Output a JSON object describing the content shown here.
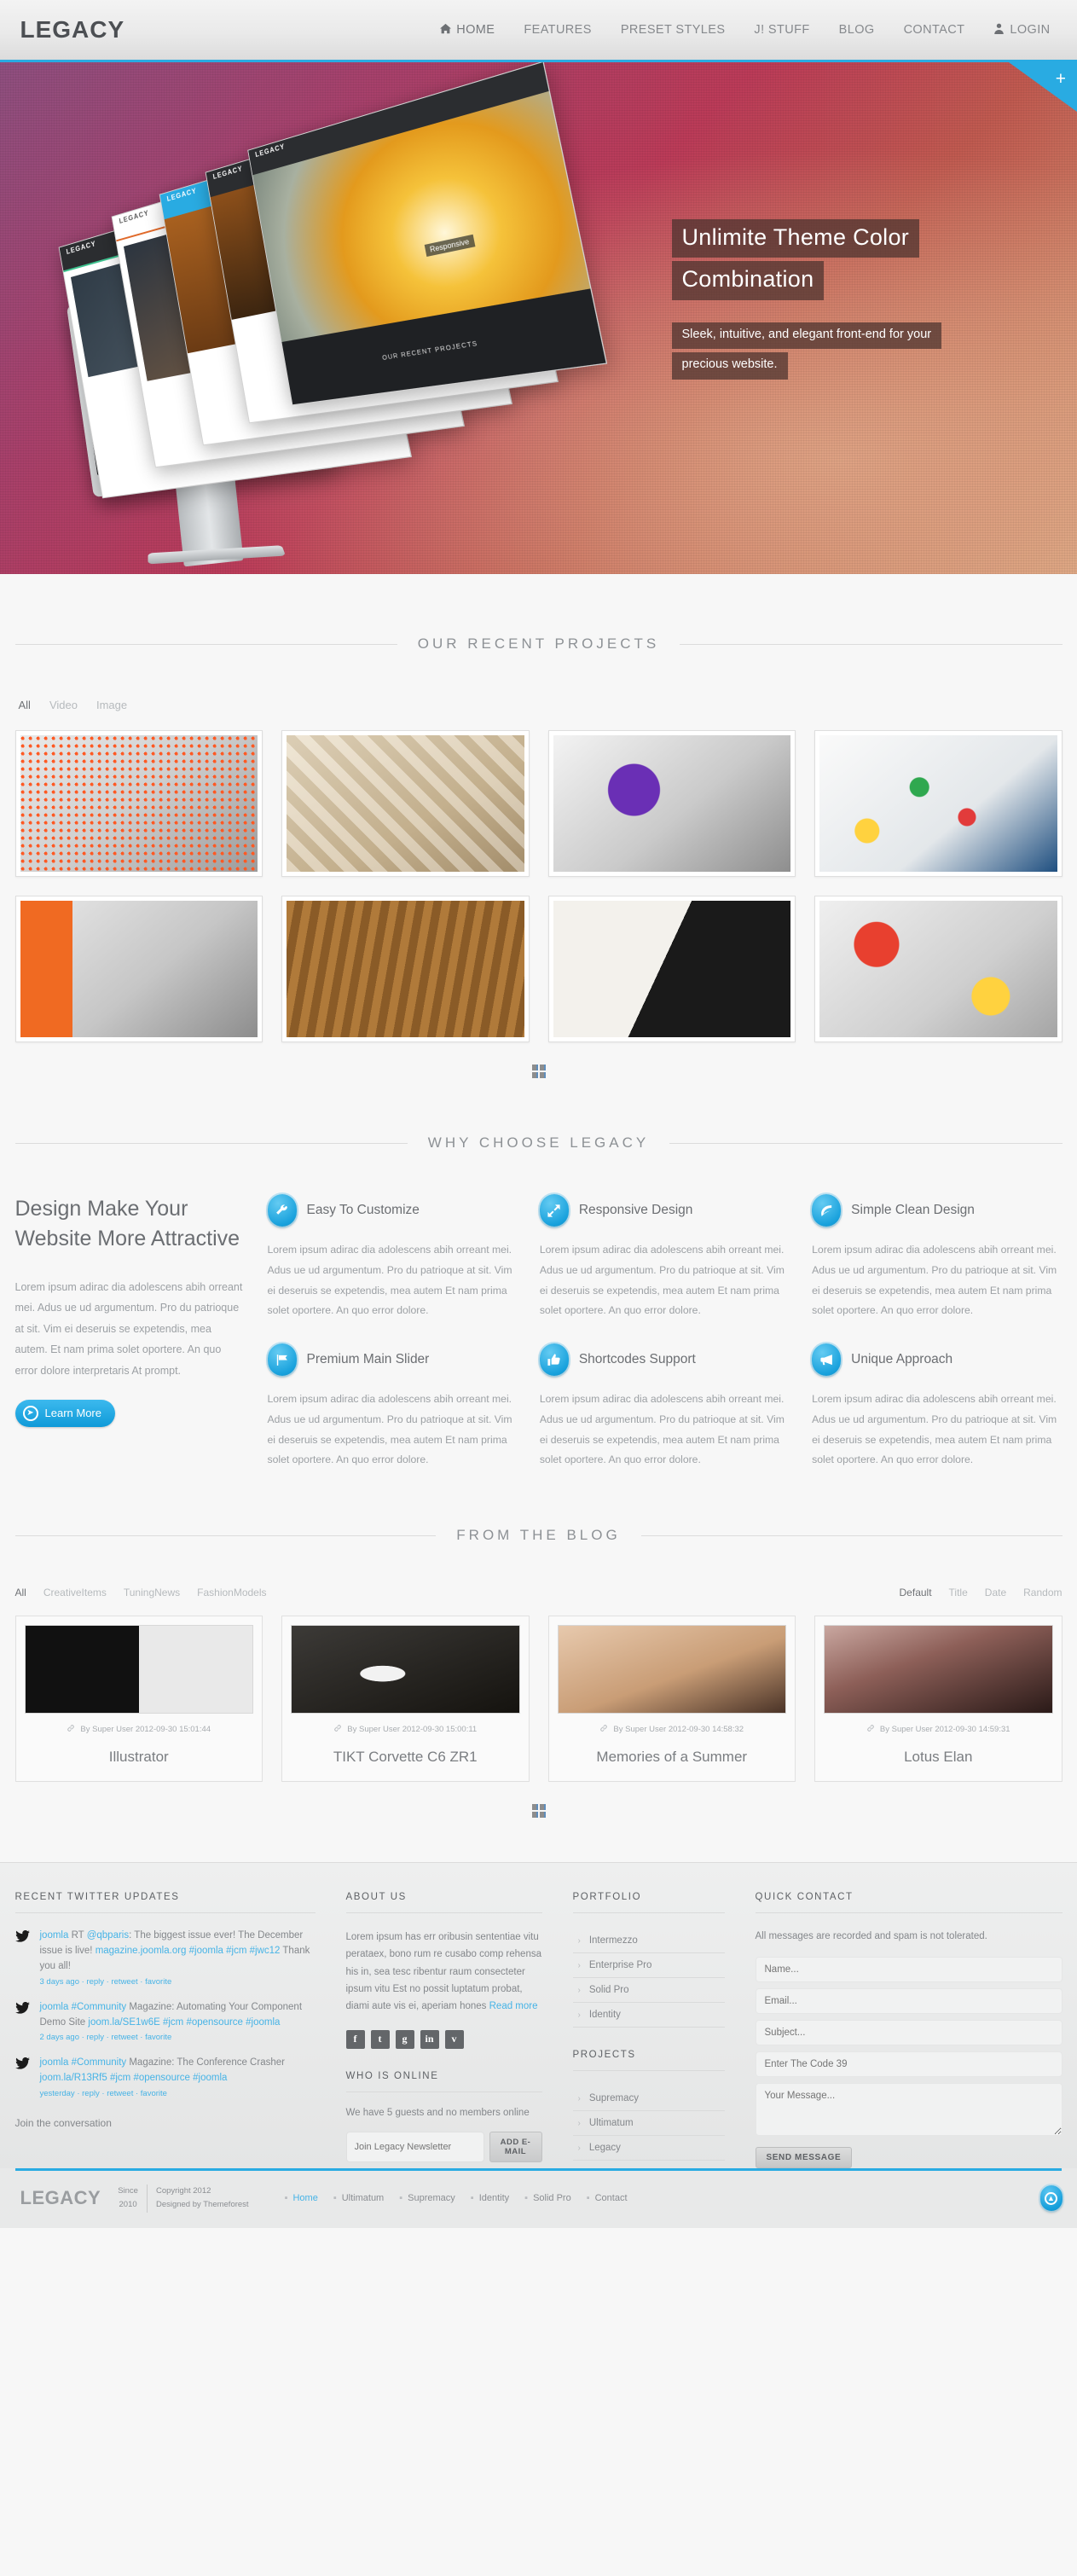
{
  "header": {
    "logo": "LEGACY",
    "nav": [
      {
        "label": "HOME",
        "icon": "home-icon",
        "active": true
      },
      {
        "label": "FEATURES",
        "active": false
      },
      {
        "label": "PRESET STYLES",
        "active": false
      },
      {
        "label": "J! STUFF",
        "active": false
      },
      {
        "label": "BLOG",
        "active": false
      },
      {
        "label": "CONTACT",
        "active": false
      },
      {
        "label": "LOGIN",
        "icon": "user-icon",
        "active": false
      }
    ]
  },
  "hero": {
    "corner_badge": "+",
    "title_line1": "Unlimite Theme Color",
    "title_line2": "Combination",
    "sub_line1": "Sleek, intuitive, and elegant front-end for your",
    "sub_line2": "precious website.",
    "mockup_logo": "LEGACY",
    "mockup_tag": "Responsive",
    "mockup_section": "OUR RECENT PROJECTS"
  },
  "projects": {
    "title": "OUR RECENT PROJECTS",
    "filters": [
      {
        "label": "All",
        "active": true
      },
      {
        "label": "Video",
        "active": false
      },
      {
        "label": "Image",
        "active": false
      }
    ],
    "items": [
      {
        "name": "project-orange-poster"
      },
      {
        "name": "project-wood-blocks"
      },
      {
        "name": "project-shirt-purple"
      },
      {
        "name": "project-identity-system"
      },
      {
        "name": "project-brochure-set"
      },
      {
        "name": "project-wood-engraved"
      },
      {
        "name": "project-black-stationery"
      },
      {
        "name": "project-colorful-cards"
      }
    ],
    "pager_icon": "grid-icon"
  },
  "why": {
    "title": "WHY CHOOSE LEGACY",
    "heading": "Design Make Your Website More Attractive",
    "paragraph": "Lorem ipsum adirac dia adolescens abih orreant mei. Adus ue ud argumentum. Pro du patrioque at sit. Vim ei deseruis se expetendis, mea autem. Et nam prima solet oportere. An quo error dolore interpretaris At prompt.",
    "button": "Learn More",
    "features": [
      {
        "icon": "wrench-icon",
        "title": "Easy To Customize",
        "text": "Lorem ipsum adirac dia adolescens abih orreant mei. Adus ue ud argumentum. Pro du patrioque at sit. Vim ei deseruis se expetendis, mea autem Et nam prima solet oportere. An quo error dolore."
      },
      {
        "icon": "expand-icon",
        "title": "Responsive Design",
        "text": "Lorem ipsum adirac dia adolescens abih orreant mei. Adus ue ud argumentum. Pro du patrioque at sit. Vim ei deseruis se expetendis, mea autem Et nam prima solet oportere. An quo error dolore."
      },
      {
        "icon": "leaf-icon",
        "title": "Simple Clean Design",
        "text": "Lorem ipsum adirac dia adolescens abih orreant mei. Adus ue ud argumentum. Pro du patrioque at sit. Vim ei deseruis se expetendis, mea autem Et nam prima solet oportere. An quo error dolore."
      },
      {
        "icon": "flag-icon",
        "title": "Premium Main Slider",
        "text": "Lorem ipsum adirac dia adolescens abih orreant mei. Adus ue ud argumentum. Pro du patrioque at sit. Vim ei deseruis se expetendis, mea autem Et nam prima solet oportere. An quo error dolore."
      },
      {
        "icon": "thumbs-up-icon",
        "title": "Shortcodes Support",
        "text": "Lorem ipsum adirac dia adolescens abih orreant mei. Adus ue ud argumentum. Pro du patrioque at sit. Vim ei deseruis se expetendis, mea autem Et nam prima solet oportere. An quo error dolore."
      },
      {
        "icon": "megaphone-icon",
        "title": "Unique Approach",
        "text": "Lorem ipsum adirac dia adolescens abih orreant mei. Adus ue ud argumentum. Pro du patrioque at sit. Vim ei deseruis se expetendis, mea autem Et nam prima solet oportere. An quo error dolore."
      }
    ]
  },
  "blog": {
    "title": "FROM THE BLOG",
    "filters": [
      {
        "label": "All",
        "active": true
      },
      {
        "label": "CreativeItems",
        "active": false
      },
      {
        "label": "TuningNews",
        "active": false
      },
      {
        "label": "FashionModels",
        "active": false
      }
    ],
    "sorts": [
      {
        "label": "Default",
        "active": true
      },
      {
        "label": "Title",
        "active": false
      },
      {
        "label": "Date",
        "active": false
      },
      {
        "label": "Random",
        "active": false
      }
    ],
    "posts": [
      {
        "meta": "By Super User 2012-09-30 15:01:44",
        "title": "Illustrator"
      },
      {
        "meta": "By Super User 2012-09-30 15:00:11",
        "title": "TIKT Corvette C6 ZR1"
      },
      {
        "meta": "By Super User 2012-09-30 14:58:32",
        "title": "Memories of a Summer"
      },
      {
        "meta": "By Super User 2012-09-30 14:59:31",
        "title": "Lotus Elan"
      }
    ],
    "pager_icon": "grid-icon"
  },
  "footer": {
    "twitter": {
      "heading": "RECENT TWITTER UPDATES",
      "tweets": [
        {
          "user": "joomla",
          "parts": [
            {
              "t": " RT ",
              "link": false
            },
            {
              "t": "@qbparis",
              "link": true
            },
            {
              "t": ": The biggest issue ever! The December issue is live! ",
              "link": false
            },
            {
              "t": "magazine.joomla.org",
              "link": true
            },
            {
              "t": " ",
              "link": false
            },
            {
              "t": "#joomla #jcm #jwc12",
              "link": true
            },
            {
              "t": " Thank you all!",
              "link": false
            }
          ],
          "time": "3 days ago",
          "actions": [
            "reply",
            "retweet",
            "favorite"
          ]
        },
        {
          "user": "joomla",
          "parts": [
            {
              "t": " ",
              "link": false
            },
            {
              "t": "#Community",
              "link": true
            },
            {
              "t": " Magazine: Automating Your Component Demo Site ",
              "link": false
            },
            {
              "t": "joom.la/SE1w6E",
              "link": true
            },
            {
              "t": " ",
              "link": false
            },
            {
              "t": "#jcm #opensource #joomla",
              "link": true
            }
          ],
          "time": "2 days ago",
          "actions": [
            "reply",
            "retweet",
            "favorite"
          ]
        },
        {
          "user": "joomla",
          "parts": [
            {
              "t": " ",
              "link": false
            },
            {
              "t": "#Community",
              "link": true
            },
            {
              "t": " Magazine: The Conference Crasher ",
              "link": false
            },
            {
              "t": "joom.la/R13Rf5",
              "link": true
            },
            {
              "t": " ",
              "link": false
            },
            {
              "t": "#jcm #opensource #joomla",
              "link": true
            }
          ],
          "time": "yesterday",
          "actions": [
            "reply",
            "retweet",
            "favorite"
          ]
        }
      ],
      "join": "Join the conversation"
    },
    "about": {
      "heading": "ABOUT US",
      "text": "Lorem ipsum has err oribusin sententiae vitu perataex, bono rum re cusabo comp rehensa his in, sea tesc ribentur raum consecteter ipsum vitu Est no possit luptatum probat, diami aute vis ei, aperiam hones ",
      "read_more": "Read more",
      "socials": [
        {
          "name": "facebook-icon",
          "glyph": "f"
        },
        {
          "name": "twitter-icon",
          "glyph": "t"
        },
        {
          "name": "google-plus-icon",
          "glyph": "g"
        },
        {
          "name": "linkedin-icon",
          "glyph": "in"
        },
        {
          "name": "vimeo-icon",
          "glyph": "v"
        }
      ]
    },
    "online": {
      "heading": "WHO IS ONLINE",
      "text": "We have 5 guests and no members online",
      "newsletter_placeholder": "Join Legacy Newsletter",
      "newsletter_button": "ADD E-MAIL"
    },
    "portfolio": {
      "heading": "PORTFOLIO",
      "items": [
        "Intermezzo",
        "Enterprise Pro",
        "Solid Pro",
        "Identity"
      ]
    },
    "projects": {
      "heading": "PROJECTS",
      "items": [
        "Supremacy",
        "Ultimatum",
        "Legacy"
      ]
    },
    "contact": {
      "heading": "QUICK CONTACT",
      "note": "All messages are recorded and spam is not tolerated.",
      "name_placeholder": "Name...",
      "email_placeholder": "Email...",
      "subject_placeholder": "Subject...",
      "code_placeholder": "Enter The Code 39",
      "message_placeholder": "Your Message...",
      "submit": "SEND MESSAGE"
    }
  },
  "bottom": {
    "logo": "LEGACY",
    "since_l1": "Since",
    "since_l2": "2010",
    "copy_l1": "Copyright 2012",
    "copy_l2": "Designed by Themeforest",
    "nav": [
      {
        "label": "Home",
        "active": true
      },
      {
        "label": "Ultimatum",
        "active": false
      },
      {
        "label": "Supremacy",
        "active": false
      },
      {
        "label": "Identity",
        "active": false
      },
      {
        "label": "Solid Pro",
        "active": false
      },
      {
        "label": "Contact",
        "active": false
      }
    ],
    "to_top_icon": "arrow-up-icon"
  },
  "colors": {
    "accent": "#29abe2",
    "text": "#6f7276",
    "muted": "#9ca0a4"
  }
}
